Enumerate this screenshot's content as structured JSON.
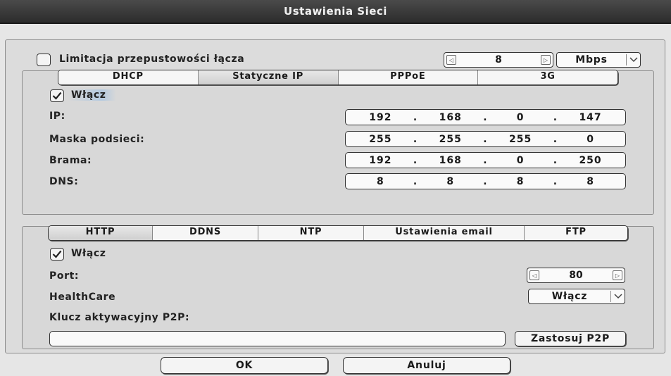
{
  "window": {
    "title": "Ustawienia Sieci"
  },
  "bandwidth": {
    "label": "Limitacja przepustowości łącza",
    "checked": false,
    "value": "8",
    "unit": "Mbps"
  },
  "network_tabs": [
    "DHCP",
    "Statyczne IP",
    "PPPoE",
    "3G"
  ],
  "network_active_tab": "Statyczne IP",
  "network": {
    "enable_label": "Włącz",
    "enable_checked": true,
    "ip_label": "IP:",
    "ip": [
      "192",
      "168",
      "0",
      "147"
    ],
    "mask_label": "Maska podsieci:",
    "mask": [
      "255",
      "255",
      "255",
      "0"
    ],
    "gateway_label": "Brama:",
    "gateway": [
      "192",
      "168",
      "0",
      "250"
    ],
    "dns_label": "DNS:",
    "dns": [
      "8",
      "8",
      "8",
      "8"
    ],
    "separator": "."
  },
  "service_tabs": [
    "HTTP",
    "DDNS",
    "NTP",
    "Ustawienia email",
    "FTP"
  ],
  "service_active_tab": "HTTP",
  "http": {
    "enable_label": "Włącz",
    "enable_checked": true,
    "port_label": "Port:",
    "port_value": "80",
    "healthcare_label": "HealthCare",
    "healthcare_value": "Włącz",
    "p2p_label": "Klucz aktywacyjny P2P:",
    "p2p_value": "",
    "p2p_apply_label": "Zastosuj P2P"
  },
  "footer": {
    "ok_label": "OK",
    "cancel_label": "Anuluj"
  },
  "icons": {
    "check": "checkmark-icon",
    "left": "arrow-left-icon",
    "right": "arrow-right-icon",
    "chevron": "chevron-down-icon"
  }
}
